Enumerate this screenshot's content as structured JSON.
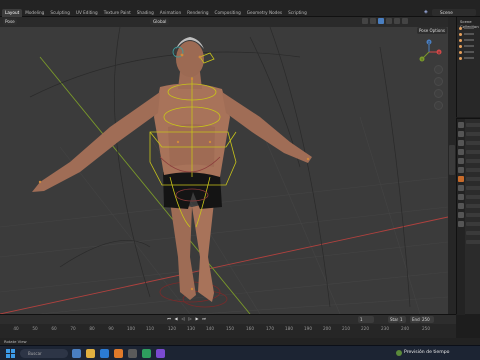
{
  "app": {
    "workspace_tabs": [
      "Layout",
      "Modeling",
      "Sculpting",
      "UV Editing",
      "Texture Paint",
      "Shading",
      "Animation",
      "Rendering",
      "Compositing",
      "Geometry Nodes",
      "Scripting"
    ],
    "active_tab": "Layout",
    "scene_name": "Scene"
  },
  "viewport": {
    "mode_label": "Pose",
    "orientation_label": "Global",
    "pose_options_label": "Pose Options",
    "gizmo_axes": [
      "X",
      "Y",
      "Z"
    ]
  },
  "outliner": {
    "header": "Scene Collection"
  },
  "timeline": {
    "frame_ticks": [
      "40",
      "50",
      "60",
      "70",
      "80",
      "90",
      "100",
      "110",
      "120",
      "130",
      "140",
      "150",
      "160",
      "170",
      "180",
      "190",
      "200",
      "210",
      "220",
      "230",
      "240",
      "250"
    ],
    "current_frame": "1",
    "start_label": "Start",
    "start_value": "1",
    "end_label": "End",
    "end_value": "250"
  },
  "status_bar": {
    "left_text": "Rotate View"
  },
  "taskbar": {
    "search_placeholder": "Buscar",
    "tray_text": "Previsión de tiempo"
  },
  "colors": {
    "accent": "#4a7fc1",
    "active_tab_bg": "#3d3d3d",
    "bone_color": "#c8c41a",
    "grid_axis_red": "#b0413e",
    "grid_axis_green": "#7a9a2a",
    "skin": "#a8735a"
  }
}
